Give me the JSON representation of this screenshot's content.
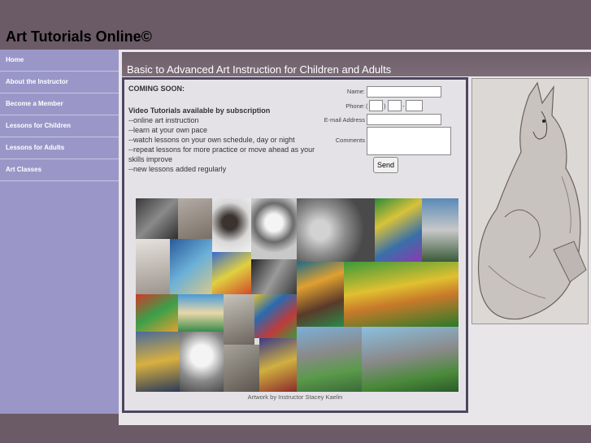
{
  "header": {
    "title": "Art Tutorials Online©"
  },
  "sidebar": {
    "items": [
      {
        "label": "Home"
      },
      {
        "label": "About the Instructor"
      },
      {
        "label": "Become a Member"
      },
      {
        "label": "Lessons for Children"
      },
      {
        "label": "Lessons for Adults"
      },
      {
        "label": "Art Classes"
      }
    ]
  },
  "main": {
    "heading": "Basic to Advanced Art Instruction for Children and Adults",
    "promo": {
      "title": "COMING SOON:",
      "subtitle": "Video Tutorials  available by subscription",
      "lines": [
        "--online art instruction",
        "--learn at your own pace",
        "--watch lessons on your own schedule, day or night",
        "--repeat lessons for more practice or move ahead as your skills improve",
        "--new lessons added regularly"
      ]
    },
    "form": {
      "name_label": "Name:",
      "phone_label": "Phone:",
      "phone_open": "(",
      "phone_close": ")",
      "phone_dash": "-",
      "email_label": "E-mail Address",
      "comments_label": "Comments",
      "send_label": "Send"
    },
    "caption": "Artwork by Instructor Stacey Kaelin"
  },
  "colors": {
    "header_bg": "#6b5b66",
    "sidebar_bg": "#9a97c8",
    "box_border": "#4e4660"
  }
}
